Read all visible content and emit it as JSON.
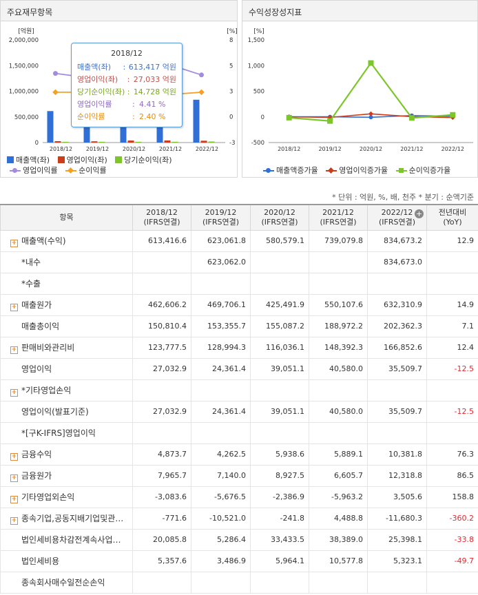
{
  "left_panel": {
    "title": "주요재무항목",
    "y_left_unit": "[억원]",
    "y_right_unit": "[%]",
    "y_left_ticks": [
      "2,000,000",
      "1,500,000",
      "1,000,000",
      "500,000",
      "0"
    ],
    "y_right_ticks": [
      "8",
      "5",
      "3",
      "0",
      "-3"
    ],
    "legend": [
      "매출액(좌)",
      "영업이익(좌)",
      "당기순이익(좌)",
      "영업이익률",
      "순이익률"
    ],
    "tooltip": {
      "title": "2018/12",
      "rows": [
        {
          "label": "매출액(좌)",
          "sep": ":",
          "value": "613,417 억원",
          "color": "#4472c4"
        },
        {
          "label": "영업이익(좌)",
          "sep": ":",
          "value": "27,033 억원",
          "color": "#c0504d"
        },
        {
          "label": "당기순이익(좌)",
          "sep": ":",
          "value": "14,728 억원",
          "color": "#7aa81e"
        },
        {
          "label": "영업이익률",
          "sep": ":",
          "value": "4.41 %",
          "color": "#8e6cbf"
        },
        {
          "label": "순이익률",
          "sep": ":",
          "value": "2.40 %",
          "color": "#e58e0c"
        }
      ]
    }
  },
  "right_panel": {
    "title": "수익성장성지표",
    "y_unit": "[%]",
    "y_ticks": [
      "1,500",
      "1,000",
      "500",
      "0",
      "-500"
    ],
    "legend": [
      "매출액증가율",
      "영업이익증가율",
      "순이익증가율"
    ]
  },
  "chart_data": [
    {
      "type": "bar",
      "title": "주요재무항목",
      "categories": [
        "2018/12",
        "2019/12",
        "2020/12",
        "2021/12",
        "2022/12"
      ],
      "ylim_left": [
        0,
        2000000
      ],
      "ylim_right": [
        -3,
        8
      ],
      "series": [
        {
          "name": "매출액(좌)",
          "axis": "left",
          "type": "bar",
          "color": "#2f6fd6",
          "values": [
            613417,
            623062,
            580579,
            739080,
            834673
          ]
        },
        {
          "name": "영업이익(좌)",
          "axis": "left",
          "type": "bar",
          "color": "#cc3b1a",
          "values": [
            27033,
            24361,
            39051,
            40580,
            35510
          ]
        },
        {
          "name": "당기순이익(좌)",
          "axis": "left",
          "type": "bar",
          "color": "#7cc62a",
          "values": [
            14728,
            15000,
            15000,
            15500,
            20000
          ]
        },
        {
          "name": "영업이익률",
          "axis": "right",
          "type": "line",
          "color": "#a58be0",
          "values": [
            4.41,
            3.9,
            6.7,
            5.5,
            4.25
          ]
        },
        {
          "name": "순이익률",
          "axis": "right",
          "type": "line",
          "color": "#f5a020",
          "values": [
            2.4,
            2.4,
            2.6,
            2.1,
            2.4
          ]
        }
      ]
    },
    {
      "type": "line",
      "title": "수익성장성지표",
      "categories": [
        "2018/12",
        "2019/12",
        "2020/12",
        "2021/12",
        "2022/12"
      ],
      "ylim": [
        -500,
        1500
      ],
      "series": [
        {
          "name": "매출액증가율",
          "color": "#2f6fd6",
          "marker": "circle",
          "values": [
            3,
            2,
            -7,
            27,
            13
          ]
        },
        {
          "name": "영업이익증가율",
          "color": "#cc3b1a",
          "marker": "diamond",
          "values": [
            2,
            -10,
            60,
            4,
            -12
          ]
        },
        {
          "name": "순이익증가율",
          "color": "#7cc62a",
          "marker": "square",
          "values": [
            -15,
            -80,
            1050,
            -20,
            40
          ]
        }
      ]
    }
  ],
  "units_note": "* 단위 : 억원, %, 배, 천주   * 분기 : 순액기준",
  "table": {
    "headers": [
      "항목",
      "2018/12\n(IFRS연결)",
      "2019/12\n(IFRS연결)",
      "2020/12\n(IFRS연결)",
      "2021/12\n(IFRS연결)",
      "2022/12\n(IFRS연결)",
      "전년대비\n(YoY)"
    ],
    "rows": [
      {
        "name": "매출액(수익)",
        "expand": true,
        "sub": false,
        "values": [
          "613,416.6",
          "623,061.8",
          "580,579.1",
          "739,079.8",
          "834,673.2",
          "12.9"
        ]
      },
      {
        "name": "*내수",
        "expand": false,
        "sub": true,
        "values": [
          "",
          "623,062.0",
          "",
          "",
          "834,673.0",
          ""
        ]
      },
      {
        "name": "*수출",
        "expand": false,
        "sub": true,
        "values": [
          "",
          "",
          "",
          "",
          "",
          ""
        ]
      },
      {
        "name": "매출원가",
        "expand": true,
        "sub": false,
        "values": [
          "462,606.2",
          "469,706.1",
          "425,491.9",
          "550,107.6",
          "632,310.9",
          "14.9"
        ]
      },
      {
        "name": "매출총이익",
        "expand": false,
        "sub": true,
        "values": [
          "150,810.4",
          "153,355.7",
          "155,087.2",
          "188,972.2",
          "202,362.3",
          "7.1"
        ]
      },
      {
        "name": "판매비와관리비",
        "expand": true,
        "sub": false,
        "values": [
          "123,777.5",
          "128,994.3",
          "116,036.1",
          "148,392.3",
          "166,852.6",
          "12.4"
        ]
      },
      {
        "name": "영업이익",
        "expand": false,
        "sub": true,
        "values": [
          "27,032.9",
          "24,361.4",
          "39,051.1",
          "40,580.0",
          "35,509.7",
          "-12.5"
        ]
      },
      {
        "name": "*기타영업손익",
        "expand": true,
        "sub": false,
        "values": [
          "",
          "",
          "",
          "",
          "",
          ""
        ]
      },
      {
        "name": "영업이익(발표기준)",
        "expand": false,
        "sub": true,
        "values": [
          "27,032.9",
          "24,361.4",
          "39,051.1",
          "40,580.0",
          "35,509.7",
          "-12.5"
        ]
      },
      {
        "name": "*[구K-IFRS]영업이익",
        "expand": false,
        "sub": true,
        "values": [
          "",
          "",
          "",
          "",
          "",
          ""
        ]
      },
      {
        "name": "금융수익",
        "expand": true,
        "sub": false,
        "values": [
          "4,873.7",
          "4,262.5",
          "5,938.6",
          "5,889.1",
          "10,381.8",
          "76.3"
        ]
      },
      {
        "name": "금융원가",
        "expand": true,
        "sub": false,
        "values": [
          "7,965.7",
          "7,140.0",
          "8,927.5",
          "6,605.7",
          "12,318.8",
          "86.5"
        ]
      },
      {
        "name": "기타영업외손익",
        "expand": true,
        "sub": false,
        "values": [
          "-3,083.6",
          "-5,676.5",
          "-2,386.9",
          "-5,963.2",
          "3,505.6",
          "158.8"
        ]
      },
      {
        "name": "종속기업,공동지배기업및관…",
        "expand": true,
        "sub": false,
        "values": [
          "-771.6",
          "-10,521.0",
          "-241.8",
          "4,488.8",
          "-11,680.3",
          "-360.2"
        ]
      },
      {
        "name": "법인세비용차감전계속사업…",
        "expand": false,
        "sub": true,
        "values": [
          "20,085.8",
          "5,286.4",
          "33,433.5",
          "38,389.0",
          "25,398.1",
          "-33.8"
        ]
      },
      {
        "name": "법인세비용",
        "expand": false,
        "sub": true,
        "values": [
          "5,357.6",
          "3,486.9",
          "5,964.1",
          "10,577.8",
          "5,323.1",
          "-49.7"
        ]
      },
      {
        "name": "종속회사매수일전순손익",
        "expand": false,
        "sub": true,
        "values": [
          "",
          "",
          "",
          "",
          "",
          ""
        ]
      }
    ]
  }
}
